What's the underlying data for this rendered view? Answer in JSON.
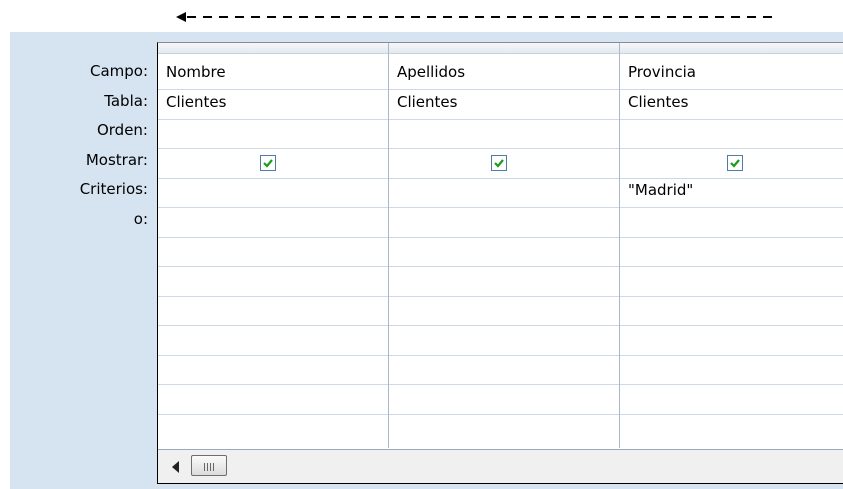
{
  "row_labels": {
    "campo": "Campo:",
    "tabla": "Tabla:",
    "orden": "Orden:",
    "mostrar": "Mostrar:",
    "criterios": "Criterios:",
    "o": "o:"
  },
  "columns": [
    {
      "campo": "Nombre",
      "tabla": "Clientes",
      "orden": "",
      "mostrar": true,
      "criterios": "",
      "o": ""
    },
    {
      "campo": "Apellidos",
      "tabla": "Clientes",
      "orden": "",
      "mostrar": true,
      "criterios": "",
      "o": ""
    },
    {
      "campo": "Provincia",
      "tabla": "Clientes",
      "orden": "",
      "mostrar": true,
      "criterios": "\"Madrid\"",
      "o": ""
    }
  ],
  "icons": {
    "check": "check-icon",
    "scroll_left": "scroll-left-arrow-icon"
  },
  "colors": {
    "panel_bg": "#d6e3f1",
    "checkmark": "#1d9b1d",
    "checkbox_border": "#4a7ea8"
  }
}
